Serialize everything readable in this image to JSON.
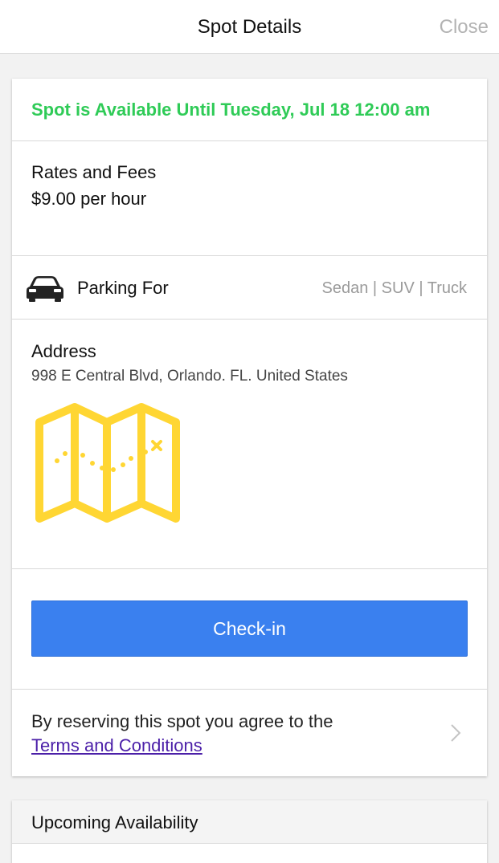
{
  "nav": {
    "title": "Spot Details",
    "close_label": "Close"
  },
  "availability": {
    "text": "Spot is Available Until Tuesday, Jul 18 12:00 am",
    "color": "#2fcb57"
  },
  "rates": {
    "title": "Rates and Fees",
    "value": "$9.00 per hour"
  },
  "parking": {
    "icon": "car-icon",
    "label": "Parking For",
    "types": "Sedan | SUV | Truck"
  },
  "address": {
    "title": "Address",
    "value": "998 E Central Blvd, Orlando. FL. United States",
    "map_icon": "map-icon",
    "map_color": "#ffd633"
  },
  "checkin": {
    "label": "Check-in",
    "color": "#3a80ef"
  },
  "terms": {
    "text": "By reserving this spot you agree to the",
    "link_label": "Terms and Conditions",
    "chevron_icon": "chevron-right-icon"
  },
  "upcoming": {
    "title": "Upcoming Availability"
  }
}
